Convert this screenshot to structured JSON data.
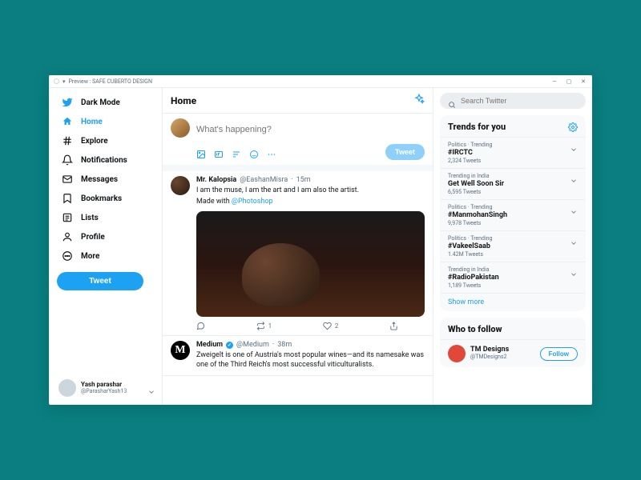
{
  "window": {
    "title": "Preview : SAFE CUBERTO DESIGN"
  },
  "nav": {
    "dark_mode": "Dark Mode",
    "items": [
      {
        "label": "Home",
        "icon": "home"
      },
      {
        "label": "Explore",
        "icon": "hash"
      },
      {
        "label": "Notifications",
        "icon": "bell"
      },
      {
        "label": "Messages",
        "icon": "mail"
      },
      {
        "label": "Bookmarks",
        "icon": "bookmark"
      },
      {
        "label": "Lists",
        "icon": "list"
      },
      {
        "label": "Profile",
        "icon": "profile"
      },
      {
        "label": "More",
        "icon": "more"
      }
    ],
    "tweet_label": "Tweet"
  },
  "account": {
    "name": "Yash parashar",
    "handle": "@ParasharYash13"
  },
  "main": {
    "title": "Home",
    "compose_placeholder": "What's happening?",
    "compose_btn": "Tweet"
  },
  "tweets": [
    {
      "name": "Mr. Kalopsia",
      "handle": "@EashanMisra",
      "time": "15m",
      "text": "I am the muse, I am the art and I am also the artist.",
      "text2_prefix": "Made with ",
      "text2_link": "@Photoshop",
      "rt": "1",
      "like": "2"
    },
    {
      "name": "Medium",
      "handle": "@Medium",
      "time": "38m",
      "text": "Zweigelt is one of Austria's most popular wines—and its namesake was one of the Third Reich's most successful viticulturalists."
    }
  ],
  "search": {
    "placeholder": "Search Twitter"
  },
  "trends": {
    "title": "Trends for you",
    "show_more": "Show more",
    "items": [
      {
        "ctx": "Politics · Trending",
        "name": "#IRCTC",
        "count": "2,324 Tweets"
      },
      {
        "ctx": "Trending in India",
        "name": "Get Well Soon Sir",
        "count": "6,595 Tweets"
      },
      {
        "ctx": "Politics · Trending",
        "name": "#ManmohanSingh",
        "count": "9,978 Tweets"
      },
      {
        "ctx": "Politics · Trending",
        "name": "#VakeelSaab",
        "count": "1.42M Tweets"
      },
      {
        "ctx": "Trending in India",
        "name": "#RadioPakistan",
        "count": "1,189 Tweets"
      }
    ]
  },
  "wtf": {
    "title": "Who to follow",
    "user": {
      "name": "TM Designs",
      "handle": "@TMDesigns2"
    },
    "follow_label": "Follow"
  }
}
